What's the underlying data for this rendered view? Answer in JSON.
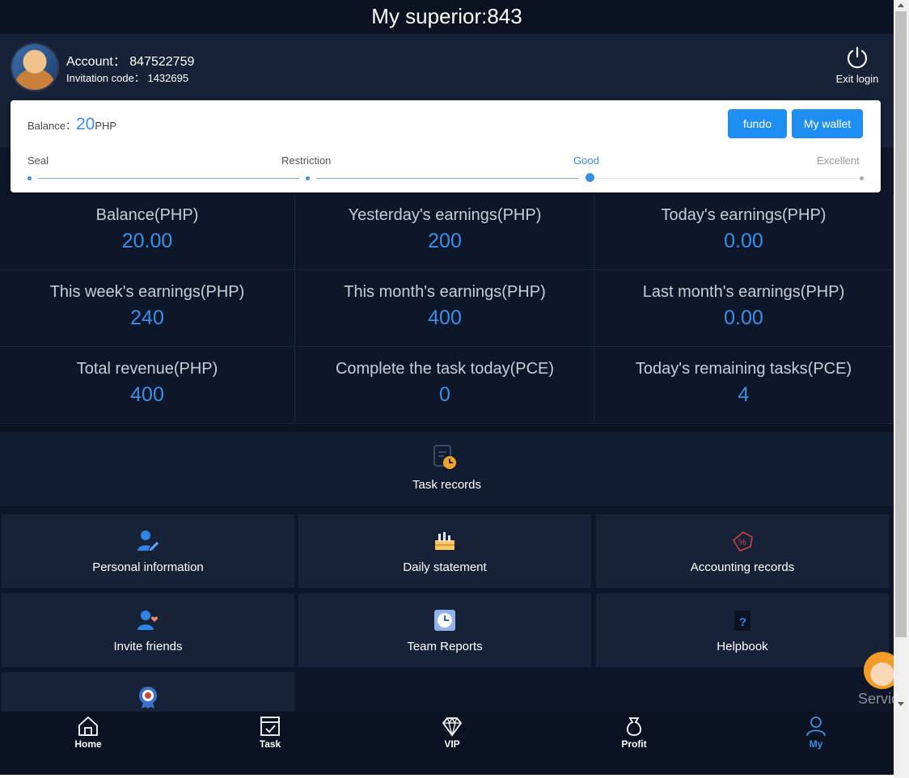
{
  "header": {
    "title": "My superior:843"
  },
  "profile": {
    "account_label": "Account：",
    "account": "847522759",
    "invite_label": "Invitation code：",
    "invite_code": "1432695",
    "exit_label": "Exit login"
  },
  "card": {
    "balance_label": "Balance：",
    "balance_value": "20",
    "balance_currency": "PHP",
    "fundo_label": "fundo",
    "wallet_label": "My wallet",
    "levels": [
      "Seal",
      "Restriction",
      "Good",
      "Excellent"
    ],
    "current_level": "Good"
  },
  "stats": [
    {
      "label": "Balance(PHP)",
      "value": "20.00"
    },
    {
      "label": "Yesterday's earnings(PHP)",
      "value": "200"
    },
    {
      "label": "Today's earnings(PHP)",
      "value": "0.00"
    },
    {
      "label": "This week's earnings(PHP)",
      "value": "240"
    },
    {
      "label": "This month's earnings(PHP)",
      "value": "400"
    },
    {
      "label": "Last month's earnings(PHP)",
      "value": "0.00"
    },
    {
      "label": "Total revenue(PHP)",
      "value": "400"
    },
    {
      "label": "Complete the task today(PCE)",
      "value": "0"
    },
    {
      "label": "Today's remaining tasks(PCE)",
      "value": "4"
    }
  ],
  "task_records": {
    "label": "Task records",
    "icon": "clipboard-clock-icon"
  },
  "menu": [
    {
      "label": "Personal information",
      "icon": "user-edit-icon"
    },
    {
      "label": "Daily statement",
      "icon": "bar-chart-icon"
    },
    {
      "label": "Accounting records",
      "icon": "percent-tag-icon"
    },
    {
      "label": "Invite friends",
      "icon": "user-heart-icon"
    },
    {
      "label": "Team Reports",
      "icon": "clock-report-icon"
    },
    {
      "label": "Helpbook",
      "icon": "help-book-icon"
    },
    {
      "label": "",
      "icon": "badge-medal-icon"
    }
  ],
  "nav": [
    {
      "label": "Home",
      "icon": "home-icon"
    },
    {
      "label": "Task",
      "icon": "calendar-check-icon"
    },
    {
      "label": "VIP",
      "icon": "diamond-icon"
    },
    {
      "label": "Profit",
      "icon": "money-bag-icon"
    },
    {
      "label": "My",
      "icon": "user-icon",
      "active": true
    }
  ],
  "service": {
    "label": "Service"
  },
  "colors": {
    "accent": "#3a8ee6",
    "button": "#1f8ef1",
    "bg": "#0e1729",
    "panel": "#172238"
  }
}
